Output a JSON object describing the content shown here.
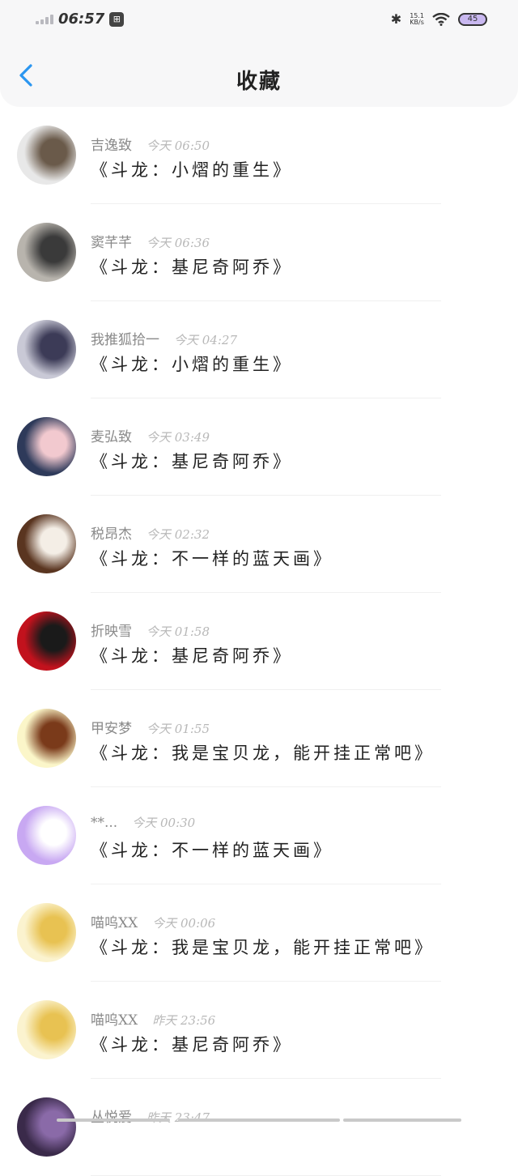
{
  "status_bar": {
    "time": "06:57",
    "app_badge": "⊞",
    "bluetooth_icon": "bluetooth-icon",
    "net_speed_value": "15.1",
    "net_speed_unit": "KB/s",
    "wifi_icon": "wifi-icon",
    "battery": "45"
  },
  "header": {
    "back_icon": "chevron-left-icon",
    "title": "收藏",
    "accent_color": "#2b96f0"
  },
  "items": [
    {
      "name": "吉逸致",
      "time": "今天 06:50",
      "book": "《斗龙：小熠的重生》",
      "avatar_colors": [
        "#e8e8e8",
        "#6a5a4a"
      ]
    },
    {
      "name": "窦芊芊",
      "time": "今天 06:36",
      "book": "《斗龙：基尼奇阿乔》",
      "avatar_colors": [
        "#b8b4ad",
        "#3a3a3a"
      ]
    },
    {
      "name": "我推狐拾一",
      "time": "今天 04:27",
      "book": "《斗龙：小熠的重生》",
      "avatar_colors": [
        "#c9c9d6",
        "#3c3b57"
      ]
    },
    {
      "name": "麦弘致",
      "time": "今天 03:49",
      "book": "《斗龙：基尼奇阿乔》",
      "avatar_colors": [
        "#2e3a5a",
        "#f2c9cf"
      ]
    },
    {
      "name": "税昂杰",
      "time": "今天 02:32",
      "book": "《斗龙：不一样的蓝天画》",
      "avatar_colors": [
        "#5a3520",
        "#f4eee6"
      ]
    },
    {
      "name": "折映雪",
      "time": "今天 01:58",
      "book": "《斗龙：基尼奇阿乔》",
      "avatar_colors": [
        "#c2121d",
        "#1a1a1a"
      ]
    },
    {
      "name": "甲安梦",
      "time": "今天 01:55",
      "book": "《斗龙：我是宝贝龙，能开挂正常吧》",
      "avatar_colors": [
        "#fbf6c9",
        "#7a3a1a"
      ]
    },
    {
      "name": "**...",
      "time": "今天 00:30",
      "book": "《斗龙：不一样的蓝天画》",
      "avatar_colors": [
        "#c8a8f2",
        "#ffffff"
      ]
    },
    {
      "name": "喵呜XX",
      "time": "今天 00:06",
      "book": "《斗龙：我是宝贝龙，能开挂正常吧》",
      "avatar_colors": [
        "#fbf3cf",
        "#e8c252"
      ]
    },
    {
      "name": "喵呜XX",
      "time": "昨天 23:56",
      "book": "《斗龙：基尼奇阿乔》",
      "avatar_colors": [
        "#fbf3cf",
        "#e8c252"
      ]
    },
    {
      "name": "丛悦爱",
      "time": "昨天 23:47",
      "book": "",
      "avatar_colors": [
        "#3a2a4a",
        "#8a6aa8"
      ]
    }
  ]
}
